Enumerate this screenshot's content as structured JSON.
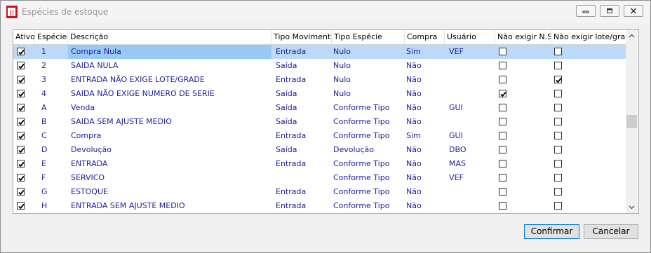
{
  "window": {
    "title": "Espécies de estoque"
  },
  "columns": {
    "ativo": "Ativo",
    "especie": "Espécie",
    "descricao": "Descrição",
    "tipo_movimento": "Tipo Movimento",
    "tipo_especie": "Tipo Espécie",
    "compra": "Compra",
    "usuario": "Usuário",
    "nao_exigir_ns": "Não exigir N.S.",
    "nao_exigir_lote": "Não exigir lote/grade"
  },
  "rows": [
    {
      "ativo": true,
      "especie": "1",
      "descricao": "Compra Nula",
      "tipo_movimento": "Entrada",
      "tipo_especie": "Nulo",
      "compra": "Sim",
      "usuario": "VEF",
      "nao_exigir_ns": false,
      "nao_exigir_lote": false,
      "selected": true
    },
    {
      "ativo": true,
      "especie": "2",
      "descricao": "SAIDA NULA",
      "tipo_movimento": "Saída",
      "tipo_especie": "Nulo",
      "compra": "Não",
      "usuario": "",
      "nao_exigir_ns": false,
      "nao_exigir_lote": false
    },
    {
      "ativo": true,
      "especie": "3",
      "descricao": "ENTRADA NÃO EXIGE LOTE/GRADE",
      "tipo_movimento": "Entrada",
      "tipo_especie": "Nulo",
      "compra": "Não",
      "usuario": "",
      "nao_exigir_ns": false,
      "nao_exigir_lote": true
    },
    {
      "ativo": true,
      "especie": "4",
      "descricao": "SAIDA NÃO EXIGE NUMERO DE SERIE",
      "tipo_movimento": "Saída",
      "tipo_especie": "Nulo",
      "compra": "Não",
      "usuario": "",
      "nao_exigir_ns": true,
      "nao_exigir_lote": false
    },
    {
      "ativo": true,
      "especie": "A",
      "descricao": "Venda",
      "tipo_movimento": "Saída",
      "tipo_especie": "Conforme Tipo",
      "compra": "Não",
      "usuario": "GUI",
      "nao_exigir_ns": false,
      "nao_exigir_lote": false
    },
    {
      "ativo": true,
      "especie": "B",
      "descricao": "SAIDA SEM AJUSTE MEDIO",
      "tipo_movimento": "Saída",
      "tipo_especie": "Conforme Tipo",
      "compra": "Não",
      "usuario": "",
      "nao_exigir_ns": false,
      "nao_exigir_lote": false
    },
    {
      "ativo": true,
      "especie": "C",
      "descricao": "Compra",
      "tipo_movimento": "Entrada",
      "tipo_especie": "Conforme Tipo",
      "compra": "Sim",
      "usuario": "GUI",
      "nao_exigir_ns": false,
      "nao_exigir_lote": false
    },
    {
      "ativo": true,
      "especie": "D",
      "descricao": "Devolução",
      "tipo_movimento": "Saída",
      "tipo_especie": "Devolução",
      "compra": "Não",
      "usuario": "DBO",
      "nao_exigir_ns": false,
      "nao_exigir_lote": false
    },
    {
      "ativo": true,
      "especie": "E",
      "descricao": "ENTRADA",
      "tipo_movimento": "Entrada",
      "tipo_especie": "Conforme Tipo",
      "compra": "Não",
      "usuario": "MAS",
      "nao_exigir_ns": false,
      "nao_exigir_lote": false
    },
    {
      "ativo": true,
      "especie": "F",
      "descricao": "SERVICO",
      "tipo_movimento": "",
      "tipo_especie": "Conforme Tipo",
      "compra": "Não",
      "usuario": "VEF",
      "nao_exigir_ns": false,
      "nao_exigir_lote": false
    },
    {
      "ativo": true,
      "especie": "G",
      "descricao": "ESTOQUE",
      "tipo_movimento": "Entrada",
      "tipo_especie": "Conforme Tipo",
      "compra": "Não",
      "usuario": "",
      "nao_exigir_ns": false,
      "nao_exigir_lote": false
    },
    {
      "ativo": true,
      "especie": "H",
      "descricao": "ENTRADA SEM AJUSTE MEDIO",
      "tipo_movimento": "Entrada",
      "tipo_especie": "Conforme Tipo",
      "compra": "Não",
      "usuario": "",
      "nao_exigir_ns": false,
      "nao_exigir_lote": false
    }
  ],
  "buttons": {
    "confirmar": "Confirmar",
    "cancelar": "Cancelar"
  },
  "icons": {
    "app": "app-logo-icon",
    "minimize": "minimize-icon",
    "maximize": "maximize-icon",
    "close": "close-icon",
    "scroll_up": "chevron-up-icon",
    "scroll_down": "chevron-down-icon",
    "checkmark": "checkmark-icon"
  },
  "colors": {
    "selection": "#bcd9f7",
    "cell_text": "#1d1d9c",
    "default_button_border": "#0078d7"
  }
}
